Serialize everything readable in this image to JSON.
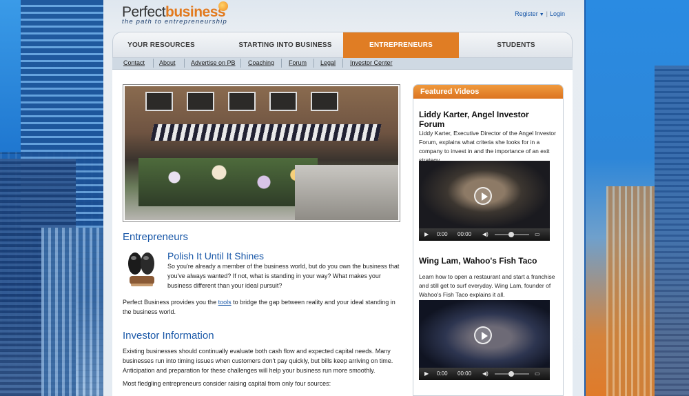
{
  "logo": {
    "word1": "Perfect",
    "word2": "business",
    "tagline": "the path to entrepreneurship"
  },
  "auth": {
    "register": "Register",
    "login": "Login"
  },
  "nav": {
    "tabs": [
      {
        "label": "YOUR RESOURCES",
        "active": false
      },
      {
        "label": "STARTING INTO BUSINESS",
        "active": false
      },
      {
        "label": "ENTREPRENEURS",
        "active": true
      },
      {
        "label": "STUDENTS",
        "active": false
      }
    ],
    "sub": [
      "Contact",
      "About",
      "Advertise on PB",
      "Coaching",
      "Forum",
      "Legal",
      "Investor Center"
    ]
  },
  "main": {
    "section1_title": "Entrepreneurs",
    "polish_title": "Polish It Until It Shines",
    "polish_text": "So you're already a member of the business world, but do you own the business that you've always wanted? If not, what is standing in your way? What makes your business different than your ideal pursuit?",
    "tools_before": "Perfect Business provides you the ",
    "tools_link": "tools",
    "tools_after": " to bridge the gap between reality and your ideal standing in the business world.",
    "section2_title": "Investor Information",
    "investor_text": "Existing businesses should continually evaluate both cash flow and expected capital needs. Many businesses run into timing issues when customers don't pay quickly, but bills keep arriving on time. Anticipation and preparation for these challenges will help your business run more smoothly.",
    "fledgling_text": "Most fledgling entrepreneurs consider raising capital from only four sources:"
  },
  "sidebar": {
    "heading": "Featured Videos",
    "videos": [
      {
        "title": "Liddy Karter, Angel Investor Forum",
        "desc": "Liddy Karter, Executive Director of the Angel Investor Forum, explains what criteria she looks for in a company to invest in and the importance of an exit strategy.",
        "time": "0:00",
        "duration": "00:00"
      },
      {
        "title": "Wing Lam, Wahoo's Fish Taco",
        "desc": "Learn how to open a restaurant and start a franchise and still get to surf everyday. Wing Lam, founder of Wahoo's Fish Taco explains it all.",
        "time": "0:00",
        "duration": "00:00"
      }
    ]
  },
  "colors": {
    "accent": "#e07d24",
    "link": "#1a58a8"
  }
}
